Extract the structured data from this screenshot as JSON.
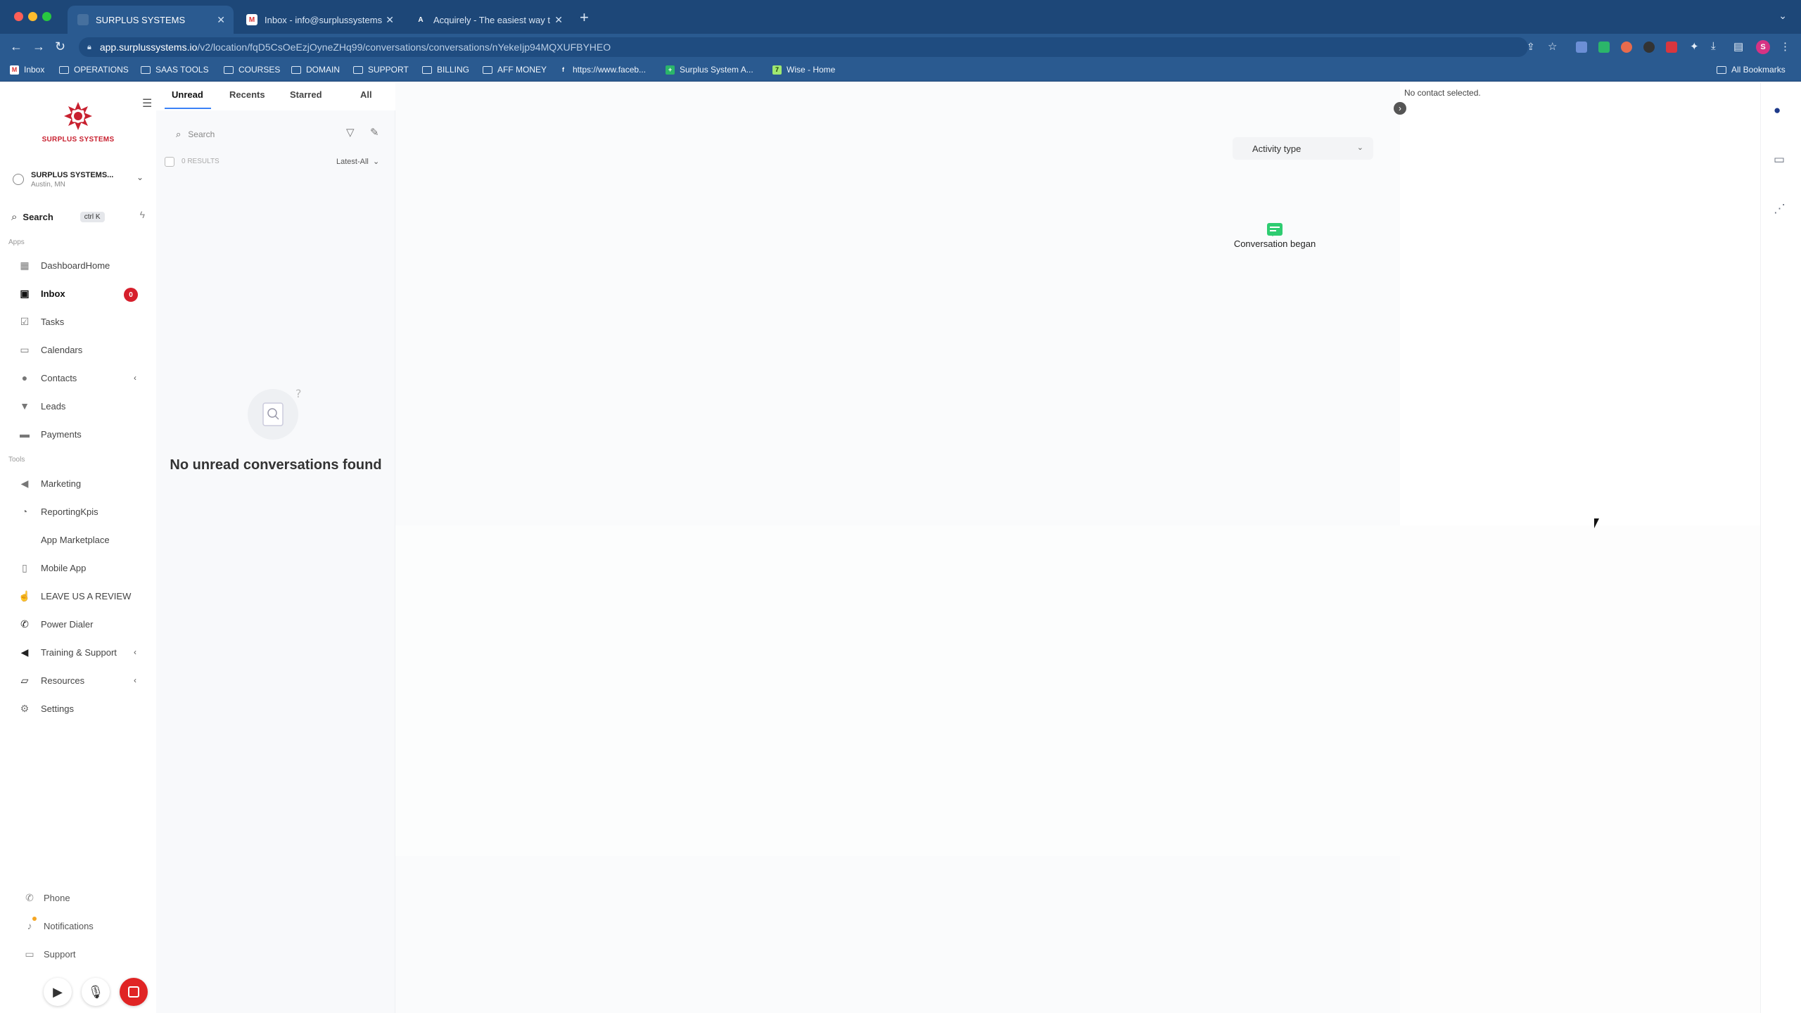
{
  "browser": {
    "tabs": [
      {
        "title": "SURPLUS SYSTEMS",
        "active": true
      },
      {
        "title": "Inbox - info@surplussystems",
        "active": false
      },
      {
        "title": "Acquirely - The easiest way t",
        "active": false
      }
    ],
    "url_host": "app.surplussystems.io",
    "url_path": "/v2/location/fqD5CsOeEzjOyneZHq99/conversations/conversations/nYekeIjp94MQXUFBYHEO",
    "bookmarks": [
      "Inbox",
      "OPERATIONS",
      "SAAS TOOLS",
      "COURSES",
      "DOMAIN",
      "SUPPORT",
      "BILLING",
      "AFF MONEY",
      "https://www.faceb...",
      "Surplus System A...",
      "Wise - Home"
    ],
    "all_bookmarks": "All Bookmarks",
    "profile_initial": "S"
  },
  "sidebar": {
    "logo_text": "SURPLUS SYSTEMS",
    "account_name": "SURPLUS SYSTEMS...",
    "account_location": "Austin, MN",
    "search_label": "Search",
    "search_shortcut": "ctrl K",
    "apps_section": "Apps",
    "tools_section": "Tools",
    "items": [
      {
        "label": "DashboardHome",
        "icon": "grid-icon"
      },
      {
        "label": "Inbox",
        "icon": "inbox-icon",
        "badge": "0",
        "active": true
      },
      {
        "label": "Tasks",
        "icon": "tasks-icon"
      },
      {
        "label": "Calendars",
        "icon": "calendar-icon"
      },
      {
        "label": "Contacts",
        "icon": "contacts-icon"
      },
      {
        "label": "Leads",
        "icon": "funnel-icon"
      },
      {
        "label": "Payments",
        "icon": "payments-icon"
      }
    ],
    "tools": [
      {
        "label": "Marketing",
        "icon": "megaphone-icon"
      },
      {
        "label": "ReportingKpis",
        "icon": "chart-icon"
      },
      {
        "label": "App Marketplace",
        "icon": "none"
      },
      {
        "label": "Mobile App",
        "icon": "mobile-icon"
      },
      {
        "label": "LEAVE US A REVIEW",
        "icon": "hand-icon"
      },
      {
        "label": "Power Dialer",
        "icon": "phone-icon"
      },
      {
        "label": "Training & Support",
        "icon": "megaphone-icon"
      },
      {
        "label": "Resources",
        "icon": "folder-icon"
      },
      {
        "label": "Settings",
        "icon": "gear-icon"
      }
    ],
    "bottom": [
      {
        "label": "Phone",
        "icon": "phone-icon"
      },
      {
        "label": "Notifications",
        "icon": "bell-icon"
      },
      {
        "label": "Support",
        "icon": "support-icon"
      }
    ]
  },
  "conversations": {
    "tabs": [
      "Unread",
      "Recents",
      "Starred",
      "All"
    ],
    "search_placeholder": "Search",
    "results": "0 RESULTS",
    "sort": "Latest-All",
    "empty_message": "No unread conversations found"
  },
  "center": {
    "activity_type": "Activity type",
    "event": "Conversation began"
  },
  "contact": {
    "none_selected": "No contact selected."
  }
}
